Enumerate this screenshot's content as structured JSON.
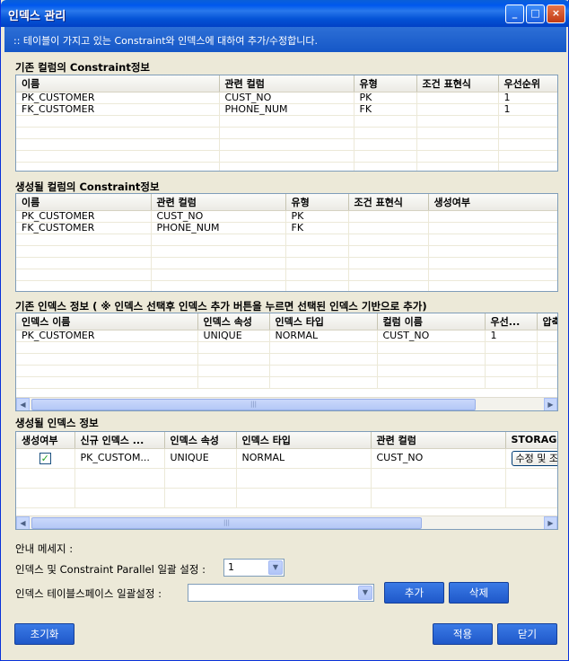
{
  "window": {
    "title": "인덱스 관리",
    "min_label": "_",
    "max_label": "□",
    "close_label": "×"
  },
  "banner": ":: 테이블이 가지고 있는 Constraint와 인덱스에 대하여 추가/수정합니다.",
  "existing_constraints": {
    "title": "기존 컬럼의 Constraint정보",
    "columns": [
      "이름",
      "관련 컬럼",
      "유형",
      "조건 표현식",
      "우선순위"
    ],
    "rows": [
      [
        "PK_CUSTOMER",
        "CUST_NO",
        "PK",
        "",
        "1"
      ],
      [
        "FK_CUSTOMER",
        "PHONE_NUM",
        "FK",
        "",
        "1"
      ]
    ]
  },
  "new_constraints": {
    "title": "생성될 컬럼의 Constraint정보",
    "columns": [
      "이름",
      "관련 컬럼",
      "유형",
      "조건 표현식",
      "생성여부"
    ],
    "rows": [
      [
        "PK_CUSTOMER",
        "CUST_NO",
        "PK",
        "",
        ""
      ],
      [
        "FK_CUSTOMER",
        "PHONE_NUM",
        "FK",
        "",
        ""
      ]
    ]
  },
  "existing_indexes": {
    "title": "기존 인덱스 정보 ( ※ 인덱스 선택후 인덱스 추가 버튼을 누르면 선택된 인덱스 기반으로 추가)",
    "columns": [
      "인덱스 이름",
      "인덱스 속성",
      "인덱스 타입",
      "컬럼 이름",
      "우선...",
      "압축"
    ],
    "rows": [
      [
        "PK_CUSTOMER",
        "UNIQUE",
        "NORMAL",
        "CUST_NO",
        "1",
        ""
      ]
    ],
    "scroll_grip": "|||"
  },
  "new_indexes": {
    "title": "생성될 인덱스 정보",
    "columns": [
      "생성여부",
      "신규 인덱스 ...",
      "인덱스 속성",
      "인덱스 타입",
      "관련 컬럼",
      "STORAGE"
    ],
    "rows": [
      {
        "checked": true,
        "check_mark": "✓",
        "name": "PK_CUSTOM...",
        "attr": "UNIQUE",
        "type": "NORMAL",
        "column": "CUST_NO",
        "storage_button": "수정 및 조"
      }
    ],
    "scroll_grip": "|||"
  },
  "message_label": "안내 메세지 :",
  "parallel": {
    "label": "인덱스 및 Constraint Parallel 일괄 설정 :",
    "value": "1"
  },
  "tablespace": {
    "label": "인덱스 테이블스페이스 일괄설정 :",
    "value": ""
  },
  "buttons": {
    "add": "추가",
    "delete": "삭제",
    "reset": "초기화",
    "apply": "적용",
    "close": "닫기"
  },
  "icons": {
    "dropdown": "▼",
    "left": "◀",
    "right": "▶"
  }
}
